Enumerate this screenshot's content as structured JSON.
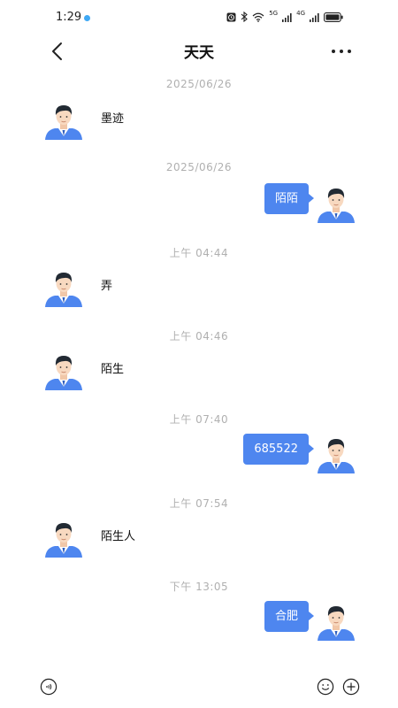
{
  "status_bar": {
    "time": "1:29",
    "signal1_label": "5G",
    "signal2_label": "4G"
  },
  "header": {
    "title": "天天"
  },
  "messages": [
    {
      "timestamp": "2025/06/26",
      "direction": "incoming",
      "text": "墨迹"
    },
    {
      "timestamp": "2025/06/26",
      "direction": "outgoing",
      "text": "陌陌"
    },
    {
      "timestamp": "上午 04:44",
      "direction": "incoming",
      "text": "弄"
    },
    {
      "timestamp": "上午 04:46",
      "direction": "incoming",
      "text": "陌生"
    },
    {
      "timestamp": "上午 07:40",
      "direction": "outgoing",
      "text": "685522"
    },
    {
      "timestamp": "上午 07:54",
      "direction": "incoming",
      "text": "陌生人"
    },
    {
      "timestamp": "下午 13:05",
      "direction": "outgoing",
      "text": "合肥"
    }
  ],
  "icons": {
    "back": "chevron-left-icon",
    "more": "more-dots-icon",
    "voice": "voice-input-icon",
    "emoji": "emoji-icon",
    "plus": "plus-icon",
    "avatar": "avatar-man-icon"
  },
  "colors": {
    "bubble": "#4e86ef",
    "timestamp": "#b0b0b0",
    "status_dot": "#3fa9f5"
  }
}
